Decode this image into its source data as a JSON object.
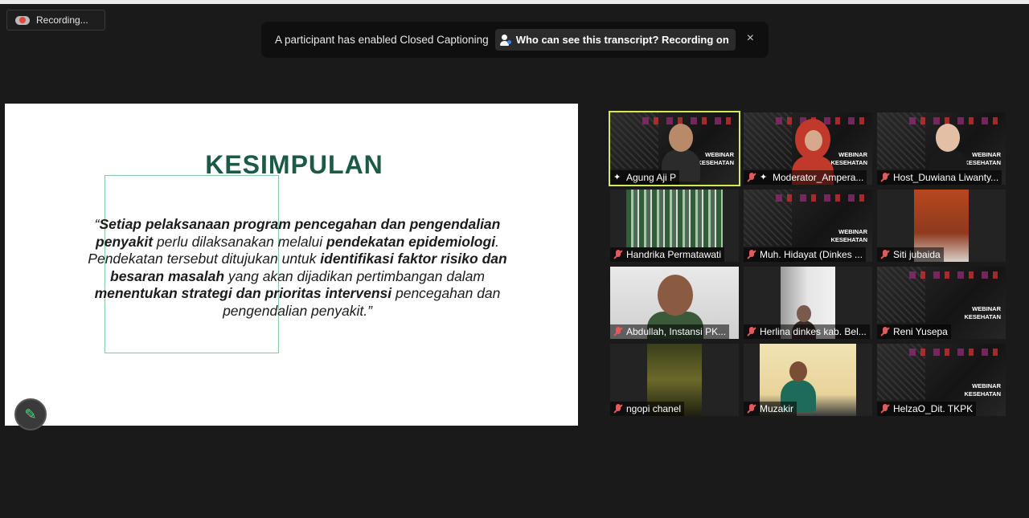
{
  "recording": {
    "label": "Recording..."
  },
  "caption_banner": {
    "message": "A participant has enabled Closed Captioning",
    "button_label": "Who can see this transcript? Recording on",
    "close": "×"
  },
  "slide": {
    "title": "KESIMPULAN",
    "quote_parts": [
      {
        "t": "“",
        "b": false
      },
      {
        "t": "Setiap pelaksanaan program pencegahan dan pengendalian penyakit",
        "b": true
      },
      {
        "t": " perlu dilaksanakan melalui ",
        "b": false
      },
      {
        "t": "pendekatan epidemiologi",
        "b": true
      },
      {
        "t": ". Pendekatan tersebut ditujukan untuk ",
        "b": false
      },
      {
        "t": "identifikasi faktor risiko dan besaran masalah",
        "b": true
      },
      {
        "t": " yang akan dijadikan pertimbangan dalam ",
        "b": false
      },
      {
        "t": "menentukan strategi dan prioritas intervensi",
        "b": true
      },
      {
        "t": " pencegahan dan pengendalian penyakit.”",
        "b": false
      }
    ]
  },
  "annotate_icon": "pencil-icon",
  "poster_text": {
    "line1": "WEBINAR",
    "line2": "KESEHATAN"
  },
  "participants": [
    {
      "name": "Agung Aji P",
      "muted": false,
      "pinned": true,
      "active": true,
      "kind": "poster-person",
      "skin": "#b88a6a",
      "shirt": "#2b2b2b"
    },
    {
      "name": "Moderator_Ampera...",
      "muted": true,
      "pinned": true,
      "active": false,
      "kind": "poster-hijab",
      "skin": "#d6a98c",
      "shirt": "#c0392b"
    },
    {
      "name": "Host_Duwiana Liwanty...",
      "muted": true,
      "pinned": false,
      "active": false,
      "kind": "poster-person",
      "skin": "#e3bfa6",
      "shirt": "#1a1a1a"
    },
    {
      "name": "Handrika Permatawati",
      "muted": true,
      "pinned": false,
      "active": false,
      "kind": "green-screen"
    },
    {
      "name": "Muh. Hidayat (Dinkes ...",
      "muted": true,
      "pinned": false,
      "active": false,
      "kind": "poster"
    },
    {
      "name": "Siti jubaida",
      "muted": true,
      "pinned": false,
      "active": false,
      "kind": "orange-room"
    },
    {
      "name": "Abdullah, Instansi PK...",
      "muted": true,
      "pinned": false,
      "active": false,
      "kind": "man-close"
    },
    {
      "name": "Herlina dinkes kab. Bel...",
      "muted": true,
      "pinned": false,
      "active": false,
      "kind": "door"
    },
    {
      "name": "Reni Yusepa",
      "muted": true,
      "pinned": false,
      "active": false,
      "kind": "poster"
    },
    {
      "name": "ngopi chanel",
      "muted": true,
      "pinned": false,
      "active": false,
      "kind": "dark-room"
    },
    {
      "name": "Muzakir",
      "muted": true,
      "pinned": false,
      "active": false,
      "kind": "man-desk"
    },
    {
      "name": "HelzaO_Dit. TKPK",
      "muted": true,
      "pinned": false,
      "active": false,
      "kind": "poster"
    }
  ]
}
